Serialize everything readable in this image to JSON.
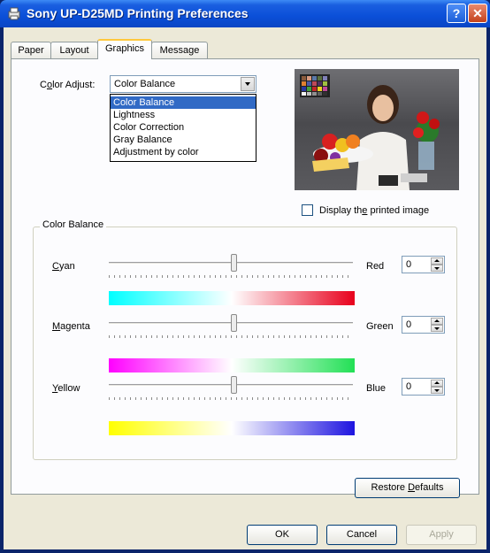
{
  "window": {
    "title": "Sony UP-D25MD Printing Preferences",
    "help_glyph": "?",
    "close_glyph": "✕"
  },
  "tabs": [
    {
      "label": "Paper",
      "active": false
    },
    {
      "label": "Layout",
      "active": false
    },
    {
      "label": "Graphics",
      "active": true
    },
    {
      "label": "Message",
      "active": false
    }
  ],
  "color_adjust": {
    "label_pre": "C",
    "label_key": "o",
    "label_post": "lor Adjust:",
    "selected": "Color Balance",
    "options": [
      "Color Balance",
      "Lightness",
      "Color Correction",
      "Gray Balance",
      "Adjustment by color"
    ]
  },
  "display_printed_image": {
    "label_pre": "Display th",
    "label_key": "e",
    "label_post": " printed image",
    "checked": false
  },
  "color_balance": {
    "group_label": "Color Balance",
    "sliders": [
      {
        "key": "C",
        "rest": "yan",
        "right_label": "Red",
        "value": "0",
        "level": 0,
        "gradient": [
          "#00ffff",
          "#ffffff",
          "#e8001c"
        ]
      },
      {
        "key": "M",
        "rest": "agenta",
        "right_label": "Green",
        "value": "0",
        "level": 0,
        "gradient": [
          "#ff00ff",
          "#ffffff",
          "#22e055"
        ]
      },
      {
        "key": "Y",
        "rest": "ellow",
        "right_label": "Blue",
        "value": "0",
        "level": 0,
        "gradient": [
          "#ffff00",
          "#ffffff",
          "#1e14e0"
        ]
      }
    ]
  },
  "buttons": {
    "restore_pre": "Restore ",
    "restore_key": "D",
    "restore_post": "efaults",
    "ok": "OK",
    "cancel": "Cancel",
    "apply": "Apply"
  },
  "colors": {
    "titlebar": "#0b4fd8",
    "selection": "#316ac5",
    "dialog_bg": "#ece9d8"
  }
}
